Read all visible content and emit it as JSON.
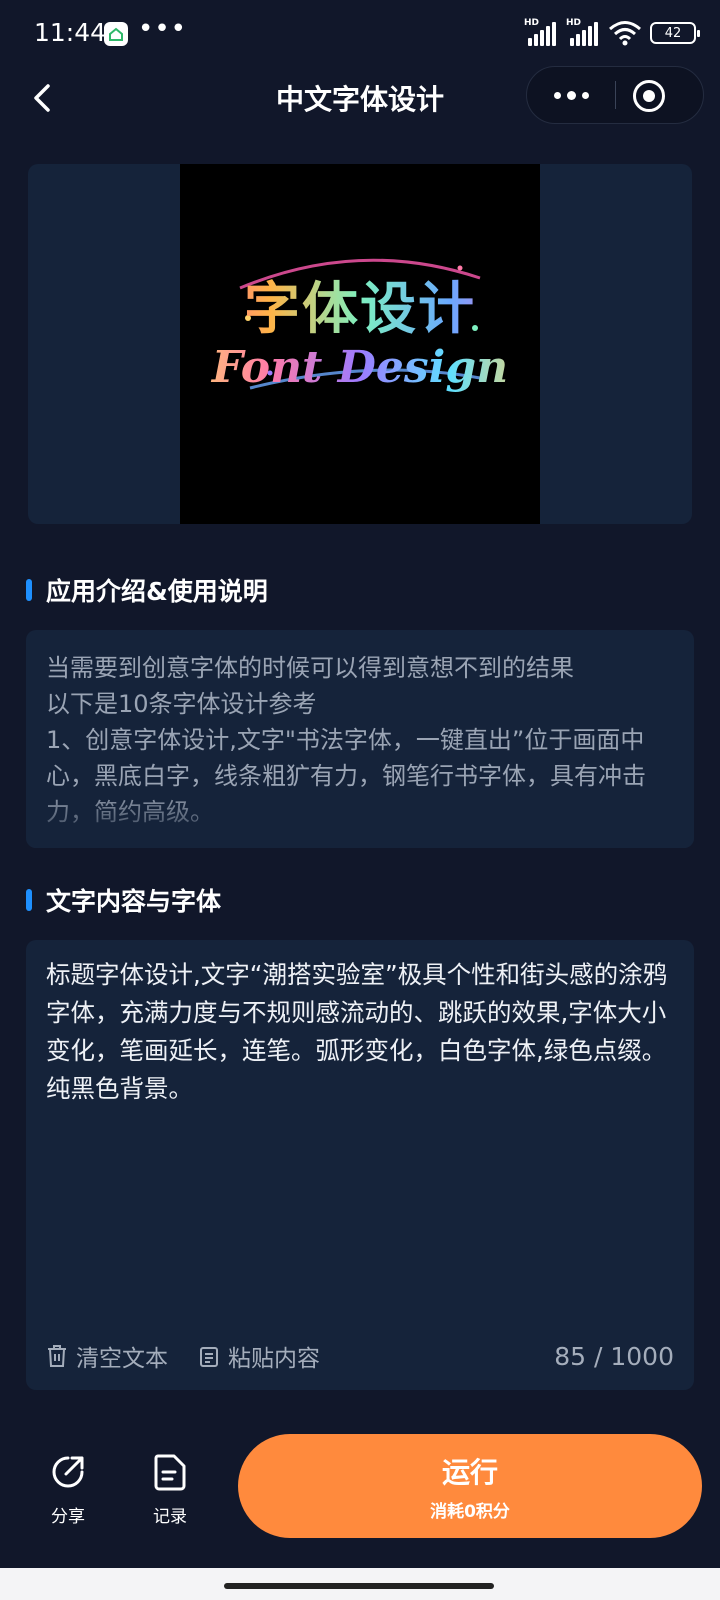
{
  "status_bar": {
    "time": "11:44",
    "dots": "•••",
    "signal1_label": "HD",
    "signal2_label": "HD",
    "battery": "42"
  },
  "nav": {
    "title": "中文字体设计"
  },
  "banner": {
    "art_text_cn": "字体设计",
    "art_text_en": "Font Design"
  },
  "intro": {
    "heading": "应用介绍&使用说明",
    "text": "当需要到创意字体的时候可以得到意想不到的结果\n以下是10条字体设计参考\n1、创意字体设计,文字\"书法字体，一键直出”位于画面中心，黑底白字，线条粗犷有力，钢笔行书字体，具有冲击力，简约高级。"
  },
  "content": {
    "heading": "文字内容与字体",
    "text": "标题字体设计,文字“潮搭实验室”极具个性和街头感的涂鸦字体，充满力度与不规则感流动的、跳跃的效果,字体大小变化，笔画延长，连笔。弧形变化，白色字体,绿色点缀。纯黑色背景。",
    "clear_label": "清空文本",
    "paste_label": "粘贴内容",
    "counter": "85 / 1000"
  },
  "bottom": {
    "share_label": "分享",
    "history_label": "记录",
    "run_label": "运行",
    "run_sub": "消耗0积分"
  },
  "colors": {
    "background": "#11172a",
    "card": "#15233a",
    "accent_blue": "#1e90ff",
    "run_orange": "#ff8a3d"
  }
}
